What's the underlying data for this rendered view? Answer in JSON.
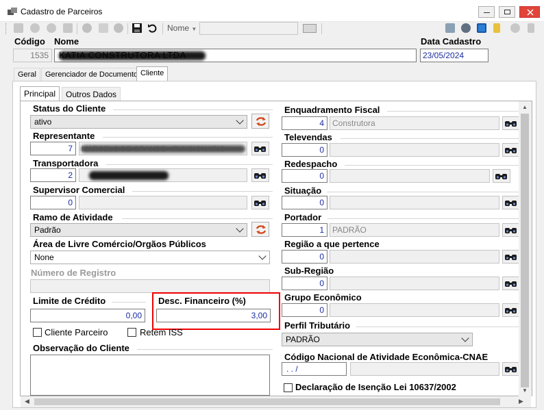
{
  "window": {
    "title": "Cadastro de Parceiros"
  },
  "toolbar": {
    "nome_combo": "Nome"
  },
  "header": {
    "codigo_label": "Código",
    "nome_label": "Nome",
    "data_label": "Data Cadastro",
    "codigo": "1535",
    "nome": "KATIA CONSTRUTORA LTDA",
    "data_cadastro": "23/05/2024"
  },
  "tabs": [
    "Geral",
    "Gerenciador de Documentos",
    "Cliente"
  ],
  "subtabs": [
    "Principal",
    "Outros Dados"
  ],
  "left": {
    "status_label": "Status do Cliente",
    "status_value": "ativo",
    "representante_label": "Representante",
    "representante_code": "7",
    "representante_name": "MARCELO DE GRANDE - FUNCIONARIO",
    "transportadora_label": "Transportadora",
    "transportadora_code": "2",
    "supervisor_label": "Supervisor Comercial",
    "supervisor_code": "0",
    "ramo_label": "Ramo de Atividade",
    "ramo_value": "Padrão",
    "area_label": "Área de Livre Comércio/Orgãos Públicos",
    "area_value": "None",
    "registro_label": "Número de Registro",
    "limite_label": "Limite de Crédito",
    "limite_value": "0,00",
    "desc_label": "Desc. Financeiro (%)",
    "desc_value": "3,00",
    "cliente_parceiro_label": "Cliente Parceiro",
    "retem_iss_label": "Retem ISS",
    "observacao_label": "Observação do Cliente"
  },
  "right": {
    "enquadramento_label": "Enquadramento Fiscal",
    "enquadramento_code": "4",
    "enquadramento_name": "Construtora",
    "televendas_label": "Televendas",
    "televendas_code": "0",
    "redespacho_label": "Redespacho",
    "redespacho_code": "0",
    "situacao_label": "Situação",
    "situacao_code": "0",
    "portador_label": "Portador",
    "portador_code": "1",
    "portador_name": "PADRÃO",
    "regiao_label": "Região a que pertence",
    "regiao_code": "0",
    "subregiao_label": "Sub-Região",
    "subregiao_code": "0",
    "grupo_label": "Grupo Econômico",
    "grupo_code": "0",
    "perfil_label": "Perfil Tributário",
    "perfil_value": "PADRÃO",
    "cnae_label": "Código Nacional de Atividade Econômica-CNAE",
    "cnae_value": ". . /",
    "declaracao_label": "Declaração de Isenção Lei 10637/2002"
  }
}
